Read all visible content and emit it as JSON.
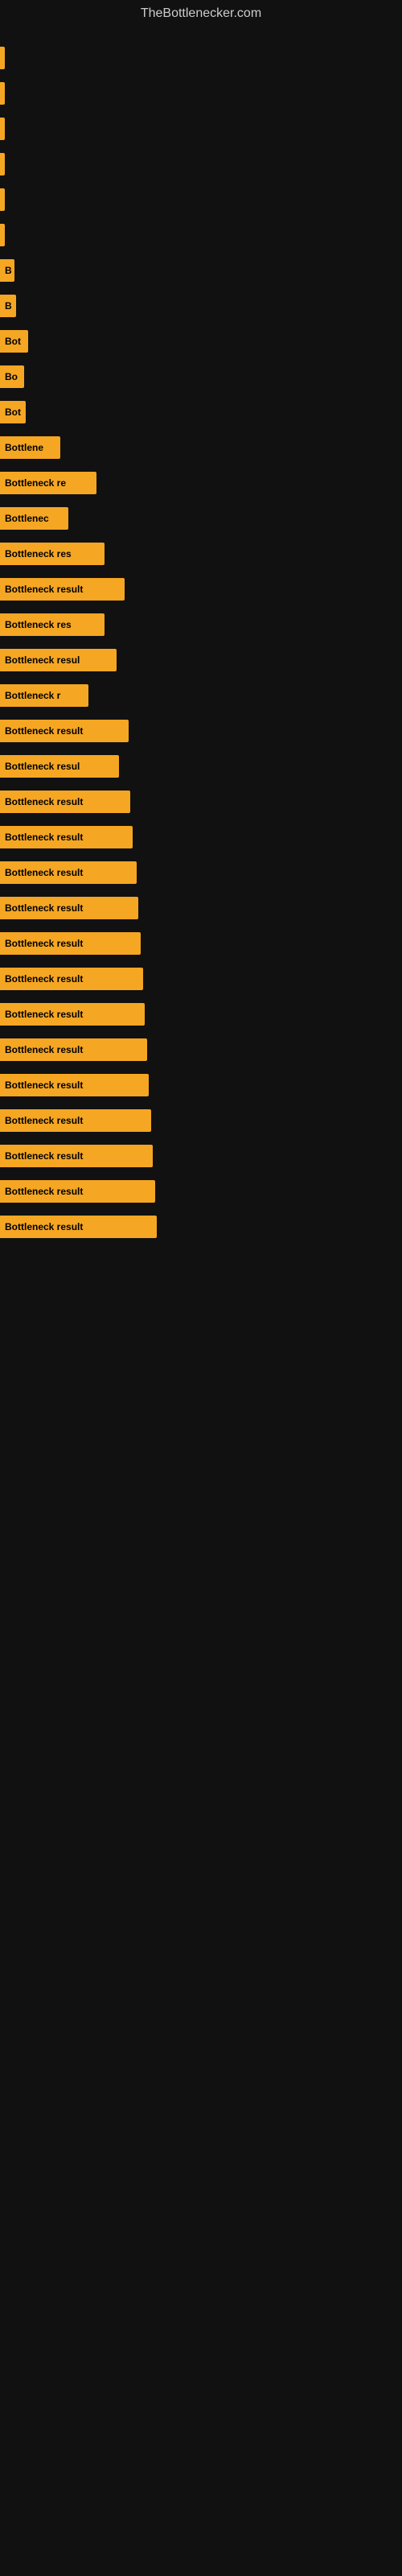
{
  "site": {
    "title": "TheBottlenecker.com"
  },
  "bars": [
    {
      "id": 1,
      "label": "",
      "width": 2
    },
    {
      "id": 2,
      "label": "",
      "width": 2
    },
    {
      "id": 3,
      "label": "",
      "width": 3
    },
    {
      "id": 4,
      "label": "",
      "width": 2
    },
    {
      "id": 5,
      "label": "",
      "width": 2
    },
    {
      "id": 6,
      "label": "",
      "width": 4
    },
    {
      "id": 7,
      "label": "B",
      "width": 18
    },
    {
      "id": 8,
      "label": "B",
      "width": 20
    },
    {
      "id": 9,
      "label": "Bot",
      "width": 35
    },
    {
      "id": 10,
      "label": "Bo",
      "width": 30
    },
    {
      "id": 11,
      "label": "Bot",
      "width": 32
    },
    {
      "id": 12,
      "label": "Bottlene",
      "width": 75
    },
    {
      "id": 13,
      "label": "Bottleneck re",
      "width": 120
    },
    {
      "id": 14,
      "label": "Bottlenec",
      "width": 85
    },
    {
      "id": 15,
      "label": "Bottleneck res",
      "width": 130
    },
    {
      "id": 16,
      "label": "Bottleneck result",
      "width": 155
    },
    {
      "id": 17,
      "label": "Bottleneck res",
      "width": 130
    },
    {
      "id": 18,
      "label": "Bottleneck resul",
      "width": 145
    },
    {
      "id": 19,
      "label": "Bottleneck r",
      "width": 110
    },
    {
      "id": 20,
      "label": "Bottleneck result",
      "width": 160
    },
    {
      "id": 21,
      "label": "Bottleneck resul",
      "width": 148
    },
    {
      "id": 22,
      "label": "Bottleneck result",
      "width": 162
    },
    {
      "id": 23,
      "label": "Bottleneck result",
      "width": 165
    },
    {
      "id": 24,
      "label": "Bottleneck result",
      "width": 170
    },
    {
      "id": 25,
      "label": "Bottleneck result",
      "width": 172
    },
    {
      "id": 26,
      "label": "Bottleneck result",
      "width": 175
    },
    {
      "id": 27,
      "label": "Bottleneck result",
      "width": 178
    },
    {
      "id": 28,
      "label": "Bottleneck result",
      "width": 180
    },
    {
      "id": 29,
      "label": "Bottleneck result",
      "width": 183
    },
    {
      "id": 30,
      "label": "Bottleneck result",
      "width": 185
    },
    {
      "id": 31,
      "label": "Bottleneck result",
      "width": 188
    },
    {
      "id": 32,
      "label": "Bottleneck result",
      "width": 190
    },
    {
      "id": 33,
      "label": "Bottleneck result",
      "width": 193
    },
    {
      "id": 34,
      "label": "Bottleneck result",
      "width": 195
    }
  ]
}
